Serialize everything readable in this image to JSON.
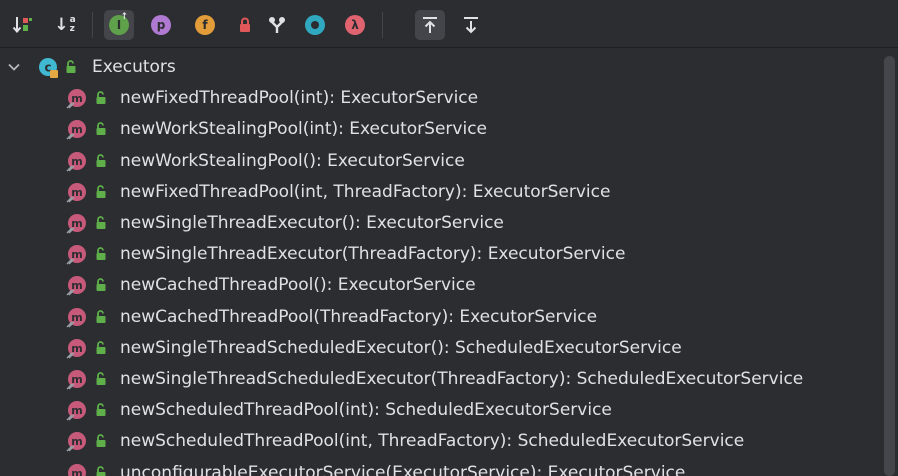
{
  "toolbar": {
    "buttons": [
      {
        "icon": "sort-by-visibility-icon",
        "active": false
      },
      {
        "icon": "sort-alphabetically-icon",
        "glyph_top": "a",
        "glyph_bottom": "z",
        "active": false
      },
      {
        "icon": "show-inherited-icon",
        "glyph": "I",
        "color": "#5fa04a",
        "active": true
      },
      {
        "icon": "show-properties-icon",
        "glyph": "p",
        "color": "#b07ad3",
        "active": false
      },
      {
        "icon": "show-fields-icon",
        "glyph": "f",
        "color": "#e39c3a",
        "active": false
      },
      {
        "icon": "show-non-public-icon",
        "color": "#e05858",
        "active": false
      },
      {
        "icon": "group-methods-icon",
        "active": false
      },
      {
        "icon": "show-anonymous-classes-icon",
        "color": "#30a9c0",
        "active": false
      },
      {
        "icon": "show-lambdas-icon",
        "glyph": "λ",
        "color": "#e06370",
        "active": false
      },
      {
        "icon": "autoscroll-to-source-icon",
        "active": true
      },
      {
        "icon": "autoscroll-from-source-icon",
        "active": false
      }
    ]
  },
  "tree": {
    "root": {
      "label": "Executors",
      "icon": "class-icon",
      "icon_glyph": "c",
      "expanded": true
    },
    "methods": [
      "newFixedThreadPool(int): ExecutorService",
      "newWorkStealingPool(int): ExecutorService",
      "newWorkStealingPool(): ExecutorService",
      "newFixedThreadPool(int, ThreadFactory): ExecutorService",
      "newSingleThreadExecutor(): ExecutorService",
      "newSingleThreadExecutor(ThreadFactory): ExecutorService",
      "newCachedThreadPool(): ExecutorService",
      "newCachedThreadPool(ThreadFactory): ExecutorService",
      "newSingleThreadScheduledExecutor(): ScheduledExecutorService",
      "newSingleThreadScheduledExecutor(ThreadFactory): ScheduledExecutorService",
      "newScheduledThreadPool(int): ScheduledExecutorService",
      "newScheduledThreadPool(int, ThreadFactory): ScheduledExecutorService",
      "unconfigurableExecutorService(ExecutorService): ExecutorService"
    ],
    "method_icon_glyph": "m"
  },
  "colors": {
    "background": "#2b2d30",
    "text": "#dfe1e5",
    "method_icon": "#c75a7a",
    "class_icon": "#3fb8d0",
    "public_lock": "#5fb04a",
    "static_lock": "#e1a844"
  }
}
